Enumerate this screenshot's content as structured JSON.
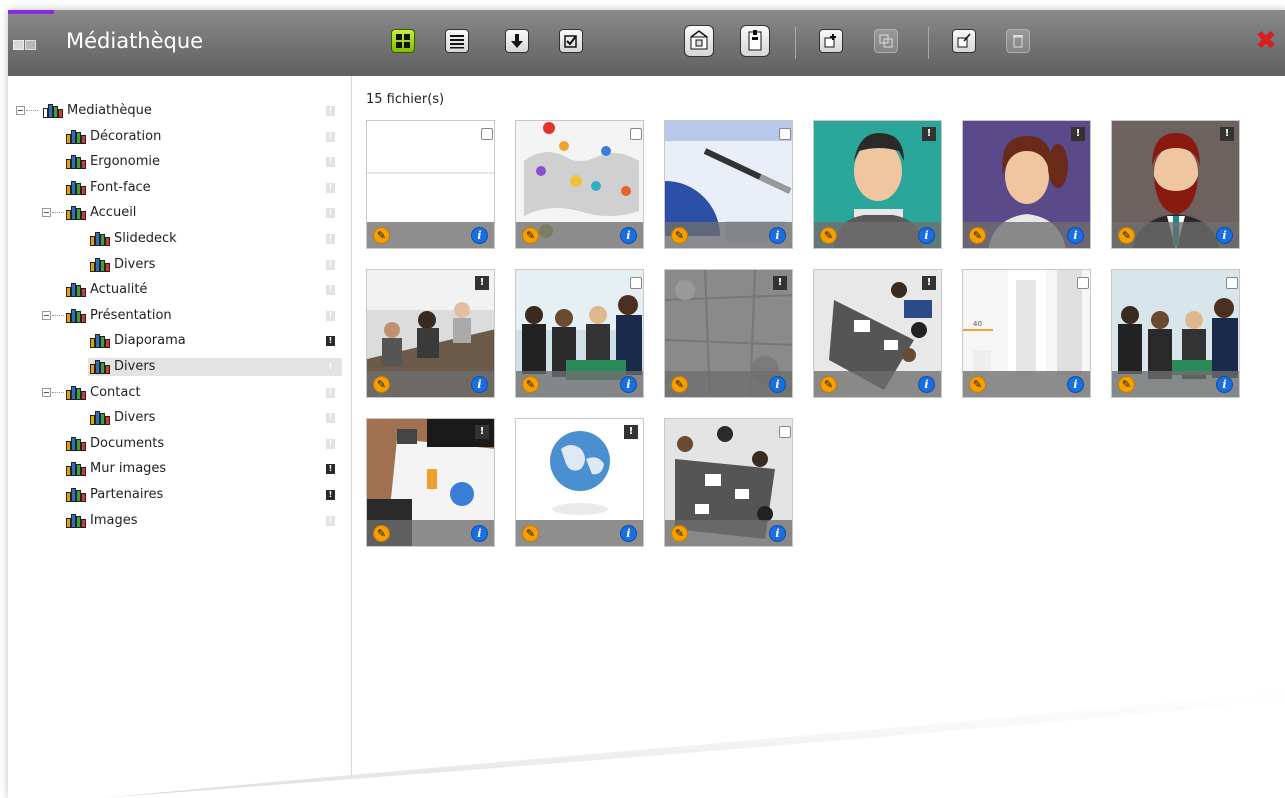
{
  "app": {
    "title": "Médiathèque"
  },
  "toolbar": {
    "buttons": [
      {
        "name": "grid-view-icon"
      },
      {
        "name": "list-view-icon"
      },
      {
        "name": "sort-down-icon"
      },
      {
        "name": "select-all-icon"
      },
      {
        "name": "upload-icon"
      },
      {
        "name": "download-icon"
      },
      {
        "name": "new-folder-icon"
      },
      {
        "name": "duplicate-icon"
      },
      {
        "name": "edit-icon"
      },
      {
        "name": "delete-icon"
      }
    ],
    "close_glyph": "✖"
  },
  "tree": [
    {
      "label": "Mediathèque",
      "level": 0,
      "toggle": true,
      "flag": false,
      "root": true
    },
    {
      "label": "Décoration",
      "level": 1,
      "toggle": false,
      "flag": false
    },
    {
      "label": "Ergonomie",
      "level": 1,
      "toggle": false,
      "flag": false
    },
    {
      "label": "Font-face",
      "level": 1,
      "toggle": false,
      "flag": false
    },
    {
      "label": "Accueil",
      "level": 1,
      "toggle": true,
      "flag": false
    },
    {
      "label": "Slidedeck",
      "level": 2,
      "toggle": false,
      "flag": false
    },
    {
      "label": "Divers",
      "level": 2,
      "toggle": false,
      "flag": false
    },
    {
      "label": "Actualité",
      "level": 1,
      "toggle": false,
      "flag": false
    },
    {
      "label": "Présentation",
      "level": 1,
      "toggle": true,
      "flag": false
    },
    {
      "label": "Diaporama",
      "level": 2,
      "toggle": false,
      "flag": true
    },
    {
      "label": "Divers",
      "level": 2,
      "toggle": false,
      "flag": false,
      "selected": true
    },
    {
      "label": "Contact",
      "level": 1,
      "toggle": true,
      "flag": false
    },
    {
      "label": "Divers",
      "level": 2,
      "toggle": false,
      "flag": false
    },
    {
      "label": "Documents",
      "level": 1,
      "toggle": false,
      "flag": false
    },
    {
      "label": "Mur images",
      "level": 1,
      "toggle": false,
      "flag": true
    },
    {
      "label": "Partenaires",
      "level": 1,
      "toggle": false,
      "flag": true
    },
    {
      "label": "Images",
      "level": 1,
      "toggle": false,
      "flag": false
    }
  ],
  "main": {
    "file_count": "15 fichier(s)",
    "files": [
      {
        "name": "blank-template",
        "marker": "checkbox"
      },
      {
        "name": "world-map-network",
        "marker": "checkbox"
      },
      {
        "name": "charts-and-pen",
        "marker": "checkbox"
      },
      {
        "name": "avatar-man",
        "marker": "flag"
      },
      {
        "name": "avatar-woman",
        "marker": "flag"
      },
      {
        "name": "avatar-bearded-man",
        "marker": "flag"
      },
      {
        "name": "office-meeting",
        "marker": "flag"
      },
      {
        "name": "business-team",
        "marker": "checkbox"
      },
      {
        "name": "stone-texture",
        "marker": "flag"
      },
      {
        "name": "team-table-top-view",
        "marker": "flag"
      },
      {
        "name": "white-chart",
        "marker": "checkbox"
      },
      {
        "name": "business-team-2",
        "marker": "checkbox"
      },
      {
        "name": "calculator-documents",
        "marker": "flag"
      },
      {
        "name": "globe",
        "marker": "flag"
      },
      {
        "name": "meeting-top-view",
        "marker": "checkbox"
      }
    ]
  }
}
